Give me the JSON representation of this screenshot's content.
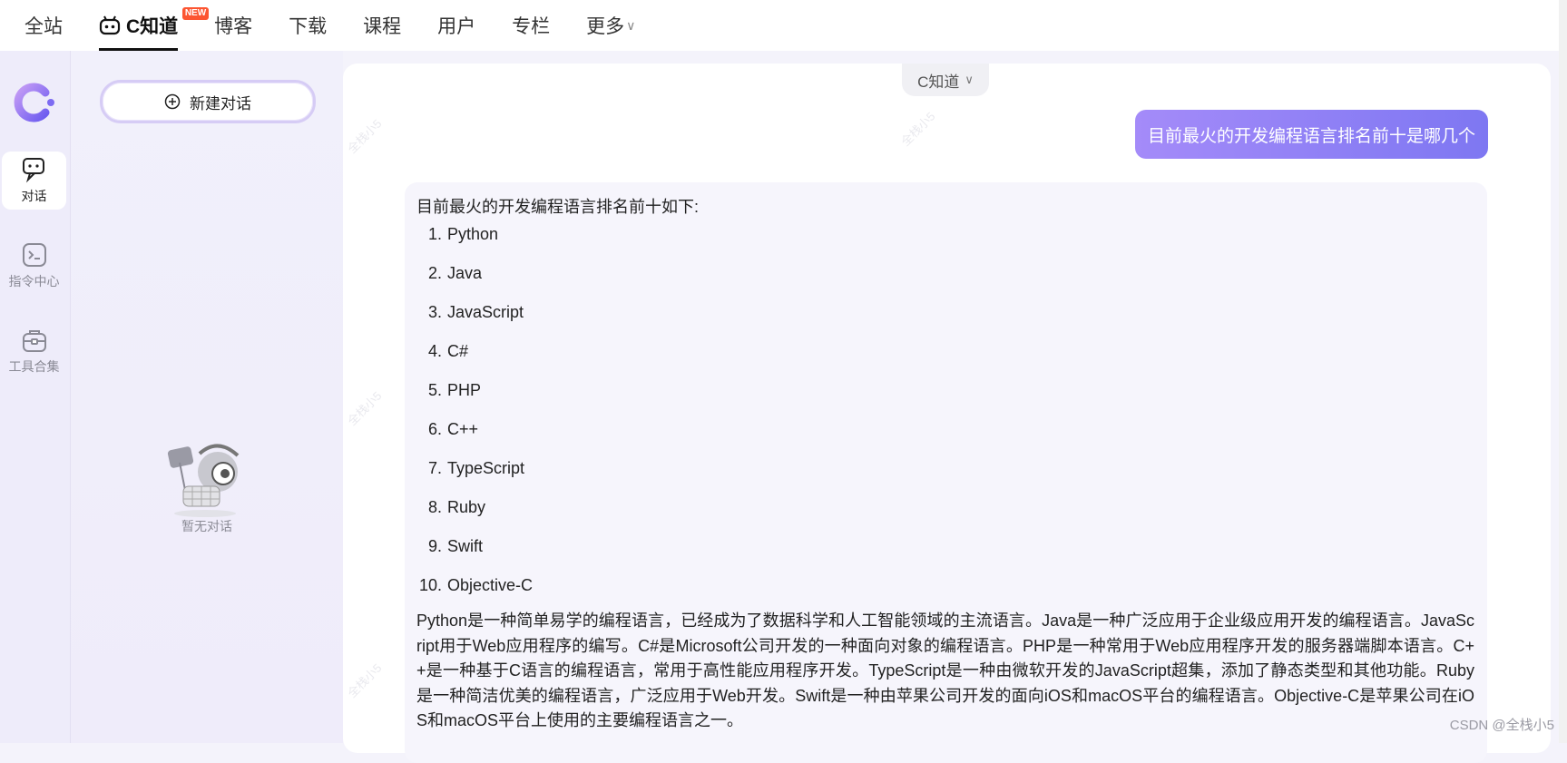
{
  "topnav": {
    "items": [
      {
        "label": "全站"
      },
      {
        "label": "C知道",
        "badge": "NEW"
      },
      {
        "label": "博客"
      },
      {
        "label": "下载"
      },
      {
        "label": "课程"
      },
      {
        "label": "用户"
      },
      {
        "label": "专栏"
      },
      {
        "label": "更多"
      }
    ]
  },
  "rail": {
    "items": [
      {
        "label": "对话",
        "icon": "chat-icon"
      },
      {
        "label": "指令中心",
        "icon": "terminal-icon"
      },
      {
        "label": "工具合集",
        "icon": "toolbox-icon"
      }
    ]
  },
  "sidebar": {
    "new_chat_label": "新建对话",
    "empty_text": "暂无对话"
  },
  "chat": {
    "model_label": "C知道",
    "user_message": "目前最火的开发编程语言排名前十是哪几个",
    "answer": {
      "intro": "目前最火的开发编程语言排名前十如下:",
      "list": [
        {
          "num": "1.",
          "text": "Python"
        },
        {
          "num": "2.",
          "text": "Java"
        },
        {
          "num": "3.",
          "text": "JavaScript"
        },
        {
          "num": "4.",
          "text": "C#"
        },
        {
          "num": "5.",
          "text": "PHP"
        },
        {
          "num": "6.",
          "text": "C++"
        },
        {
          "num": "7.",
          "text": "TypeScript"
        },
        {
          "num": "8.",
          "text": "Ruby"
        },
        {
          "num": "9.",
          "text": "Swift"
        },
        {
          "num": "10.",
          "text": "Objective-C"
        }
      ],
      "paragraph": "Python是一种简单易学的编程语言，已经成为了数据科学和人工智能领域的主流语言。Java是一种广泛应用于企业级应用开发的编程语言。JavaScript用于Web应用程序的编写。C#是Microsoft公司开发的一种面向对象的编程语言。PHP是一种常用于Web应用程序开发的服务器端脚本语言。C++是一种基于C语言的编程语言，常用于高性能应用程序开发。TypeScript是一种由微软开发的JavaScript超集，添加了静态类型和其他功能。Ruby是一种简洁优美的编程语言，广泛应用于Web开发。Swift是一种由苹果公司开发的面向iOS和macOS平台的编程语言。Objective-C是苹果公司在iOS和macOS平台上使用的主要编程语言之一。"
    }
  },
  "watermark": "全栈小5",
  "footer_watermark": "CSDN @全栈小5"
}
